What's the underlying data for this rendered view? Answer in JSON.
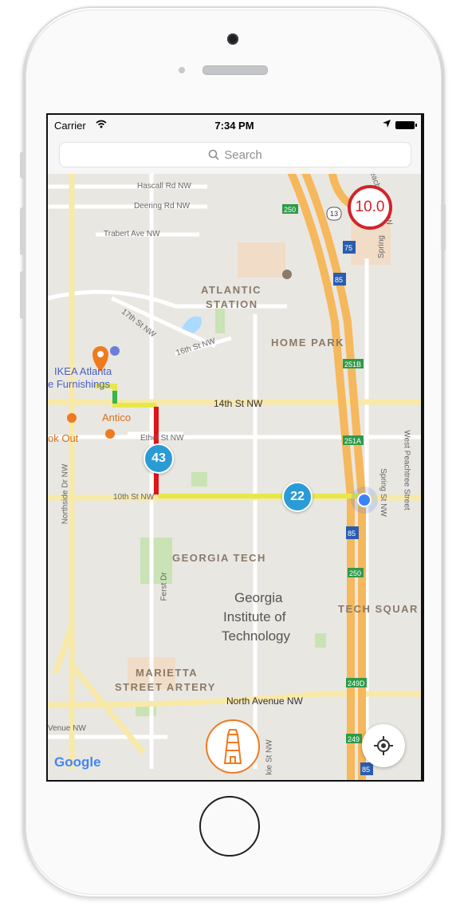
{
  "status_bar": {
    "carrier": "Carrier",
    "time": "7:34 PM"
  },
  "search": {
    "placeholder": "Search"
  },
  "speed_indicator": {
    "value": "10.0"
  },
  "route_badges": [
    "43",
    "22"
  ],
  "map_labels": {
    "roads": [
      "Hascall Rd NW",
      "Deering Rd NW",
      "Trabert Ave NW",
      "17th St NW",
      "16th St NW",
      "14th St NW",
      "Ethel St NW",
      "10th St NW",
      "Northside Dr NW",
      "Spring St NW",
      "West Peachtree Street",
      "Spring St NW",
      "North Avenue NW",
      "Ferst Dr",
      "Peachtree St NW",
      "Spring",
      "Venue NW",
      "kie St NW"
    ],
    "areas": [
      "ATLANTIC",
      "STATION",
      "HOME PARK",
      "GEORGIA TECH",
      "TECH SQUAR",
      "MARIETTA",
      "STREET ARTERY"
    ],
    "places": [
      "IKEA Atlanta",
      "e Furnishings",
      "Antico",
      "ok Out",
      "Georgia",
      "Institute of",
      "Technology"
    ],
    "highway_shields": [
      "250",
      "13",
      "75",
      "85",
      "251B",
      "251A",
      "85",
      "250",
      "249D",
      "249",
      "85"
    ]
  },
  "attribution": "Google",
  "colors": {
    "route_yellow": "#e6e84a",
    "route_red": "#e0141b",
    "route_green": "#39b54a",
    "badge_blue": "#2b9bd6",
    "speed_red": "#d2232a",
    "lighthouse_orange": "#f07a1e",
    "highway": "#f6b85c"
  },
  "icons": {
    "wifi": "wifi-icon",
    "location_arrow": "location-arrow-icon",
    "battery": "battery-icon",
    "search": "search-icon",
    "recenter": "crosshair-icon",
    "lighthouse": "lighthouse-icon",
    "pin": "map-pin-icon"
  }
}
